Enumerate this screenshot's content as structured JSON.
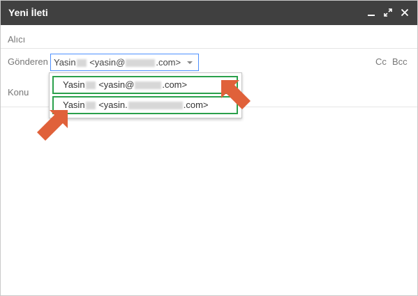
{
  "window": {
    "title": "Yeni İleti",
    "controls": [
      "minimize-icon",
      "expand-icon",
      "close-icon"
    ]
  },
  "fields": {
    "to_label": "Alıcı",
    "from_label": "Gönderen",
    "subject_label": "Konu",
    "cc_label": "Cc",
    "bcc_label": "Bcc"
  },
  "from_select": {
    "name": "Yasin",
    "email_prefix": "<yasin@",
    "email_suffix": ".com>"
  },
  "dropdown_options": [
    {
      "name": "Yasin",
      "email_prefix": "<yasin@",
      "email_suffix": ".com>"
    },
    {
      "name": "Yasin",
      "email_prefix": "<yasin.",
      "email_suffix": ".com>"
    }
  ],
  "colors": {
    "titlebar": "#404040",
    "select_border": "#4d90fe",
    "highlight_box": "#2aa04b",
    "annotation_arrow": "#e0613a"
  }
}
